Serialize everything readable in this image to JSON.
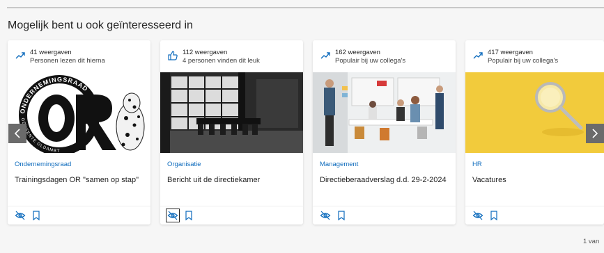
{
  "section": {
    "title": "Mogelijk bent u ook geïnteresseerd in"
  },
  "cards": [
    {
      "views": "41 weergaven",
      "reason": "Personen lezen dit hierna",
      "stat_icon": "trending-up-icon",
      "category": "Ondernemingsraad",
      "title": "Trainingsdagen OR \"samen op stap\"",
      "image_text": {
        "arc": "ONDERNEMINGSRAAD",
        "mark": "OR",
        "arc_bottom": "GEMEENTE OLDAMBT"
      }
    },
    {
      "views": "112 weergaven",
      "reason": "4 personen vinden dit leuk",
      "stat_icon": "like-icon",
      "category": "Organisatie",
      "title": "Bericht uit de directiekamer"
    },
    {
      "views": "162 weergaven",
      "reason": "Populair bij uw collega's",
      "stat_icon": "trending-up-icon",
      "category": "Management",
      "title": "Directieberaadverslag d.d. 29-2-2024"
    },
    {
      "views": "417 weergaven",
      "reason": "Populair bij uw collega's",
      "stat_icon": "trending-up-icon",
      "category": "HR",
      "title": "Vacatures"
    }
  ],
  "icons": {
    "hide": "eye-off-icon",
    "save": "bookmark-icon",
    "prev": "chevron-left-icon",
    "next": "chevron-right-icon"
  },
  "colors": {
    "accent": "#0f6cbd",
    "nav_bg": "#6b6b6b",
    "page_bg": "#f6f6f6"
  },
  "pager": {
    "text": "1 van"
  }
}
